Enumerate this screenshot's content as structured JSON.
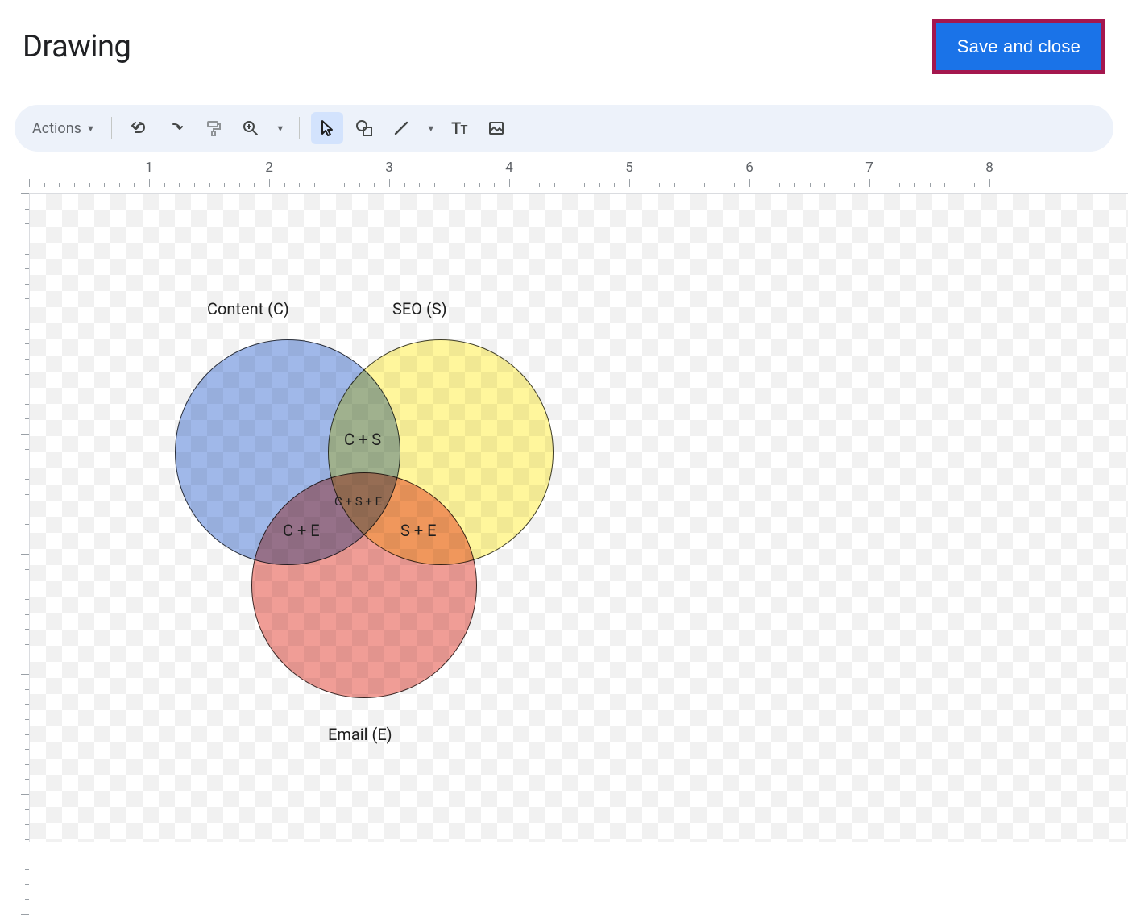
{
  "header": {
    "title": "Drawing",
    "save_label": "Save and close"
  },
  "toolbar": {
    "actions_label": "Actions",
    "tt_text": "Tᴛ"
  },
  "ruler": {
    "marks": [
      "1",
      "2",
      "3",
      "4",
      "5",
      "6",
      "7",
      "8"
    ]
  },
  "venn": {
    "labels": {
      "content": "Content (C)",
      "seo": "SEO (S)",
      "email": "Email (E)"
    },
    "intersections": {
      "cs": "C + S",
      "ce": "C + E",
      "se": "S + E",
      "cse": "C + S + E"
    }
  },
  "chart_data": {
    "type": "venn",
    "sets": [
      {
        "id": "C",
        "label": "Content (C)",
        "color": "#7b9de0"
      },
      {
        "id": "S",
        "label": "SEO (S)",
        "color": "#fff380"
      },
      {
        "id": "E",
        "label": "Email (E)",
        "color": "#ec8279"
      }
    ],
    "intersections": [
      {
        "sets": [
          "C",
          "S"
        ],
        "label": "C + S"
      },
      {
        "sets": [
          "C",
          "E"
        ],
        "label": "C + E"
      },
      {
        "sets": [
          "S",
          "E"
        ],
        "label": "S + E"
      },
      {
        "sets": [
          "C",
          "S",
          "E"
        ],
        "label": "C + S + E"
      }
    ]
  }
}
